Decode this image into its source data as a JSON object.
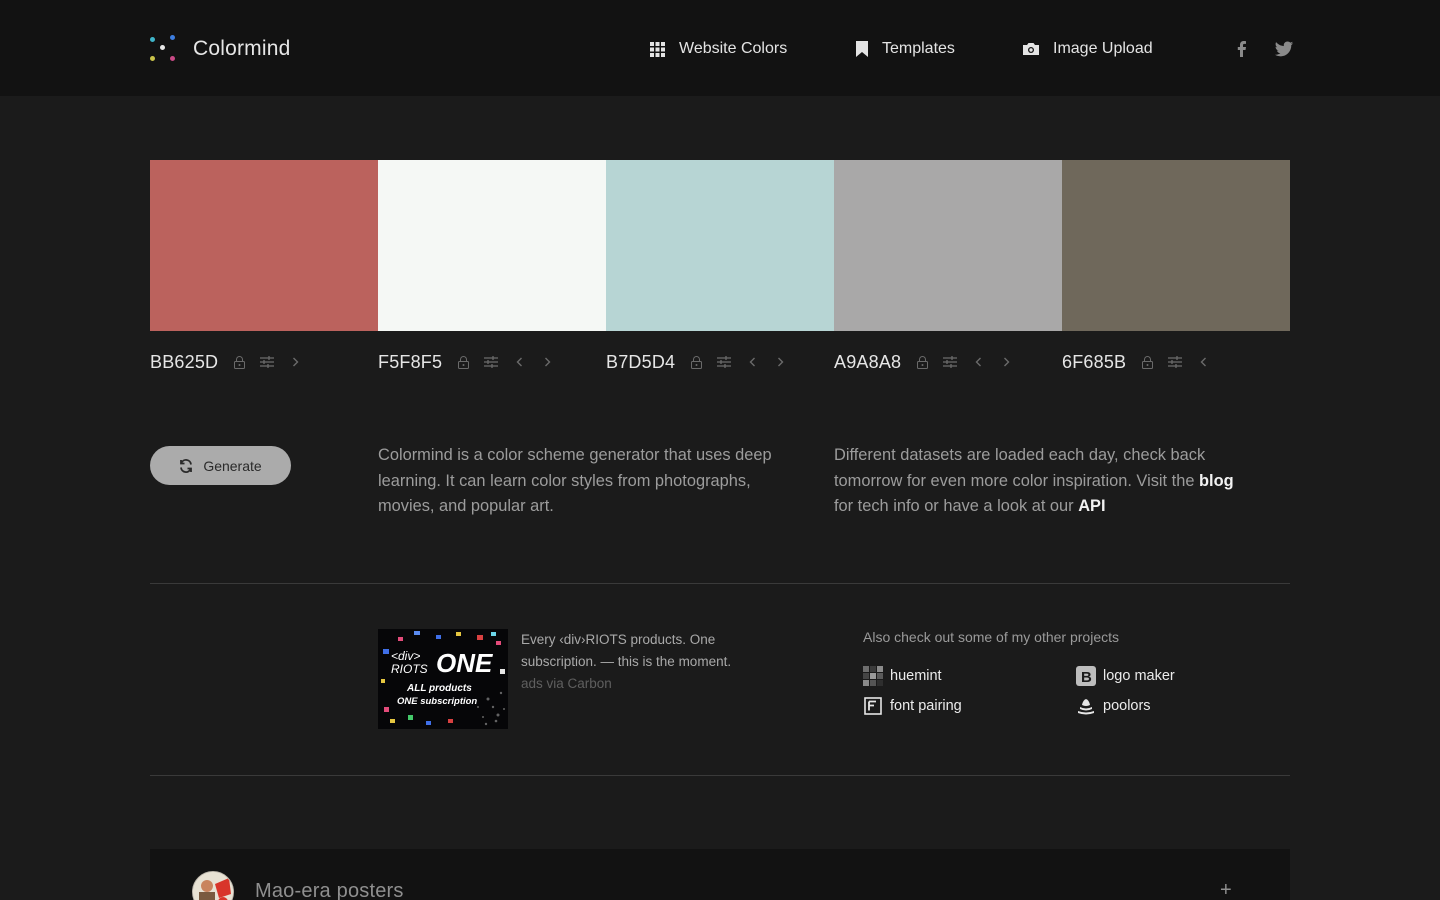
{
  "header": {
    "brand": "Colormind",
    "nav": [
      {
        "label": "Website Colors",
        "icon": "grid-icon"
      },
      {
        "label": "Templates",
        "icon": "bookmark-icon"
      },
      {
        "label": "Image Upload",
        "icon": "camera-icon"
      }
    ],
    "social": [
      "facebook-icon",
      "twitter-icon"
    ]
  },
  "palette": [
    {
      "hex": "BB625D",
      "color": "#BB625D"
    },
    {
      "hex": "F5F8F5",
      "color": "#F5F8F5"
    },
    {
      "hex": "B7D5D4",
      "color": "#B7D5D4"
    },
    {
      "hex": "A9A8A8",
      "color": "#A9A8A8"
    },
    {
      "hex": "6F685B",
      "color": "#6F685B"
    }
  ],
  "generate": {
    "label": "Generate"
  },
  "intro": {
    "left": "Colormind is a color scheme generator that uses deep learning. It can learn color styles from photographs, movies, and popular art.",
    "right_before": "Different datasets are loaded each day, check back tomorrow for even more color inspiration. Visit the ",
    "blog": "blog",
    "right_middle": " for tech info or have a look at our ",
    "api": "API"
  },
  "ad": {
    "text": "Every ‹div›RIOTS products. One subscription. — this is the moment.",
    "via": "ads via Carbon",
    "image_line1": "<div>",
    "image_line2": "RIOTS",
    "image_big": "ONE",
    "image_line3": "ALL products",
    "image_line4": "ONE subscription"
  },
  "projects": {
    "heading": "Also check out some of my other projects",
    "items": [
      {
        "label": "huemint",
        "icon": "huemint-icon"
      },
      {
        "label": "logo maker",
        "icon": "logo-maker-icon"
      },
      {
        "label": "font pairing",
        "icon": "font-pairing-icon"
      },
      {
        "label": "poolors",
        "icon": "poolors-icon"
      }
    ]
  },
  "collection": {
    "title": "Mao-era posters",
    "toggle": "+"
  },
  "colors": {
    "background": "#1b1b1b",
    "header": "#121212",
    "button": "#ababab"
  }
}
